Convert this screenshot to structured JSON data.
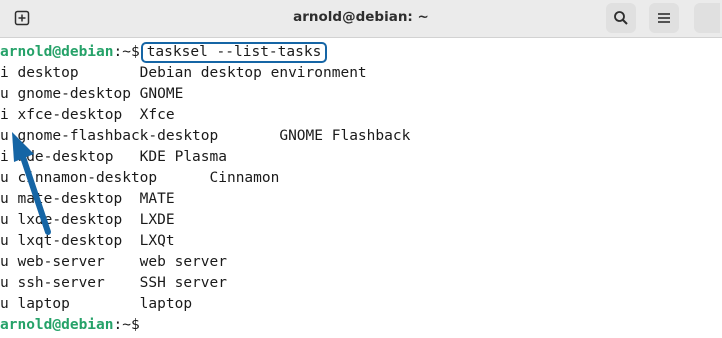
{
  "window": {
    "title": "arnold@debian: ~",
    "icons": {
      "new_tab": "plus-square-icon",
      "search": "search-icon",
      "menu": "hamburger-menu-icon",
      "close": "close-icon"
    }
  },
  "terminal": {
    "prompt_user": "arnold@debian",
    "prompt_path": ":~$",
    "command": "tasksel --list-tasks",
    "output_lines": [
      "i desktop       Debian desktop environment",
      "u gnome-desktop GNOME",
      "i xfce-desktop  Xfce",
      "u gnome-flashback-desktop       GNOME Flashback",
      "i kde-desktop   KDE Plasma",
      "u cinnamon-desktop      Cinnamon",
      "u mate-desktop  MATE",
      "u lxde-desktop  LXDE",
      "u lxqt-desktop  LXQt",
      "u web-server    web server",
      "u ssh-server    SSH server",
      "u laptop        laptop"
    ],
    "final_prompt_user": "arnold@debian",
    "final_prompt_path": ":~$ "
  },
  "colors": {
    "prompt_green": "#26a269",
    "highlight_blue": "#1565a5"
  }
}
